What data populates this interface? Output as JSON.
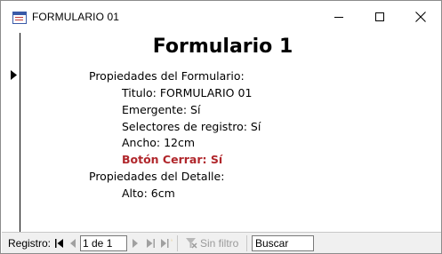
{
  "window": {
    "title": "FORMULARIO 01"
  },
  "form": {
    "title": "Formulario 1",
    "lines": {
      "props_form_heading": "Propiedades del Formulario:",
      "titulo": "Titulo: FORMULARIO 01",
      "emergente": "Emergente: Sí",
      "selectores": "Selectores de registro: Sí",
      "ancho": "Ancho: 12cm",
      "boton_cerrar": "Botón Cerrar: Sí",
      "props_detail_heading": "Propiedades del Detalle:",
      "alto": "Alto: 6cm"
    },
    "highlight_color": "#b0262b"
  },
  "navigation": {
    "label": "Registro:",
    "current_record": "1 de 1",
    "filter_label": "Sin filtro",
    "search_placeholder": "Buscar"
  }
}
